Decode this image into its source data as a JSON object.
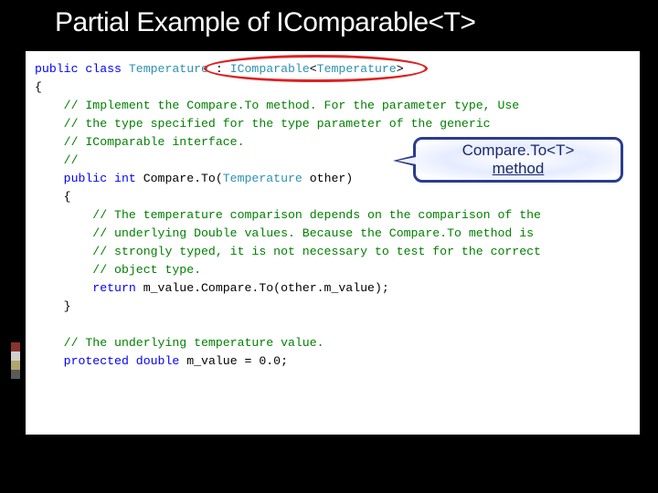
{
  "title": "Partial Example of IComparable<T>",
  "callout": {
    "line1": "Compare.To<T>",
    "line2": "method"
  },
  "code": {
    "l1a": "public",
    "l1b": " class",
    "l1c": " Temperature",
    "l1d": " : ",
    "l1e": "IComparable",
    "l1f": "<",
    "l1g": "Temperature",
    "l1h": ">",
    "l2": "{",
    "l3": "    // Implement the Compare.To method. For the parameter type, Use",
    "l4": "    // the type specified for the type parameter of the generic",
    "l5": "    // IComparable interface.",
    "l6": "    //",
    "l7a": "    public",
    "l7b": " int",
    "l7c": " Compare.To(",
    "l7d": "Temperature",
    "l7e": " other)",
    "l8": "    {",
    "l9": "        // The temperature comparison depends on the comparison of the",
    "l10": "        // underlying Double values. Because the Compare.To method is",
    "l11": "        // strongly typed, it is not necessary to test for the correct",
    "l12": "        // object type.",
    "l13a": "        return",
    "l13b": " m_value.Compare.To(other.m_value);",
    "l14": "    }",
    "l15": "",
    "l16": "    // The underlying temperature value.",
    "l17a": "    protected",
    "l17b": " double",
    "l17c": " m_value = 0.0;"
  }
}
